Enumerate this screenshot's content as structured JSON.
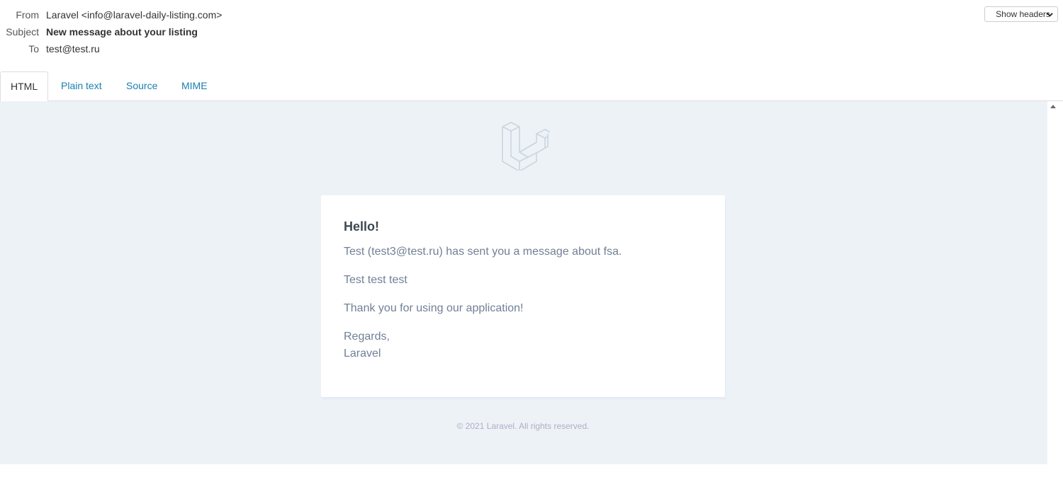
{
  "headers": {
    "from_label": "From",
    "from_value": "Laravel <info@laravel-daily-listing.com>",
    "subject_label": "Subject",
    "subject_value": "New message about your listing",
    "to_label": "To",
    "to_value": "test@test.ru",
    "show_headers_label": "Show headers"
  },
  "tabs": [
    {
      "label": "HTML",
      "active": true
    },
    {
      "label": "Plain text",
      "active": false
    },
    {
      "label": "Source",
      "active": false
    },
    {
      "label": "MIME",
      "active": false
    }
  ],
  "email": {
    "greeting": "Hello!",
    "line1": "Test (test3@test.ru) has sent you a message about fsa.",
    "line2": "Test test test",
    "line3": "Thank you for using our application!",
    "regards": "Regards,",
    "signature": "Laravel",
    "footer": "© 2021 Laravel. All rights reserved."
  },
  "colors": {
    "link": "#1a7fb0",
    "frame_bg": "#edf2f7",
    "body_text": "#718096",
    "heading_text": "#3d4852"
  }
}
